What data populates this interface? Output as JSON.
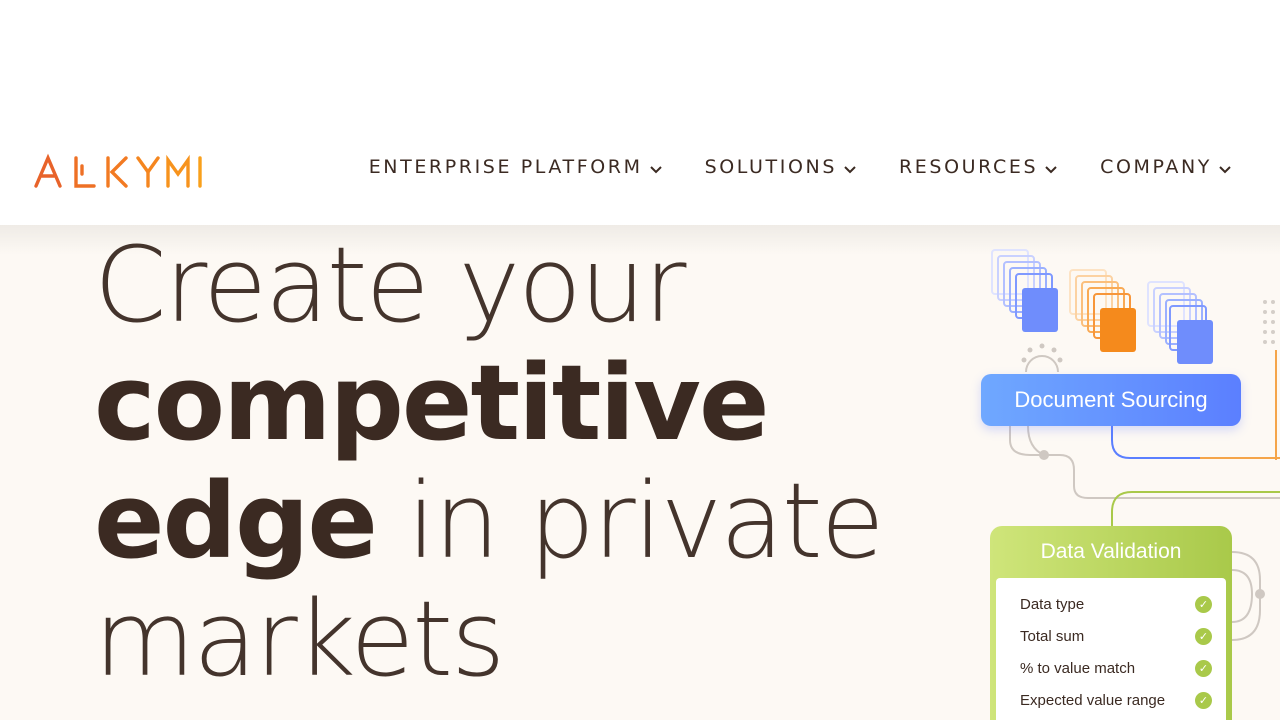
{
  "brand": {
    "logo_text": "ALKYMI",
    "logo_color": "#f07a22"
  },
  "nav": {
    "items": [
      {
        "label": "ENTERPRISE PLATFORM"
      },
      {
        "label": "SOLUTIONS"
      },
      {
        "label": "RESOURCES"
      },
      {
        "label": "COMPANY"
      }
    ]
  },
  "hero": {
    "line1": "Create your",
    "line2_bold": "competitive",
    "line3_bold": "edge",
    "line3_rest": " in private",
    "line4": "markets"
  },
  "illustration": {
    "document_sourcing_label": "Document Sourcing",
    "data_validation_title": "Data Validation",
    "checks": [
      {
        "label": "Data type"
      },
      {
        "label": "Total sum"
      },
      {
        "label": "% to value match"
      },
      {
        "label": "Expected value range"
      }
    ]
  },
  "colors": {
    "text": "#3b2a22",
    "background": "#fdf9f4",
    "blue_accent": "#5b7fff",
    "orange_accent": "#f08a22",
    "green_accent": "#a9c94a"
  }
}
